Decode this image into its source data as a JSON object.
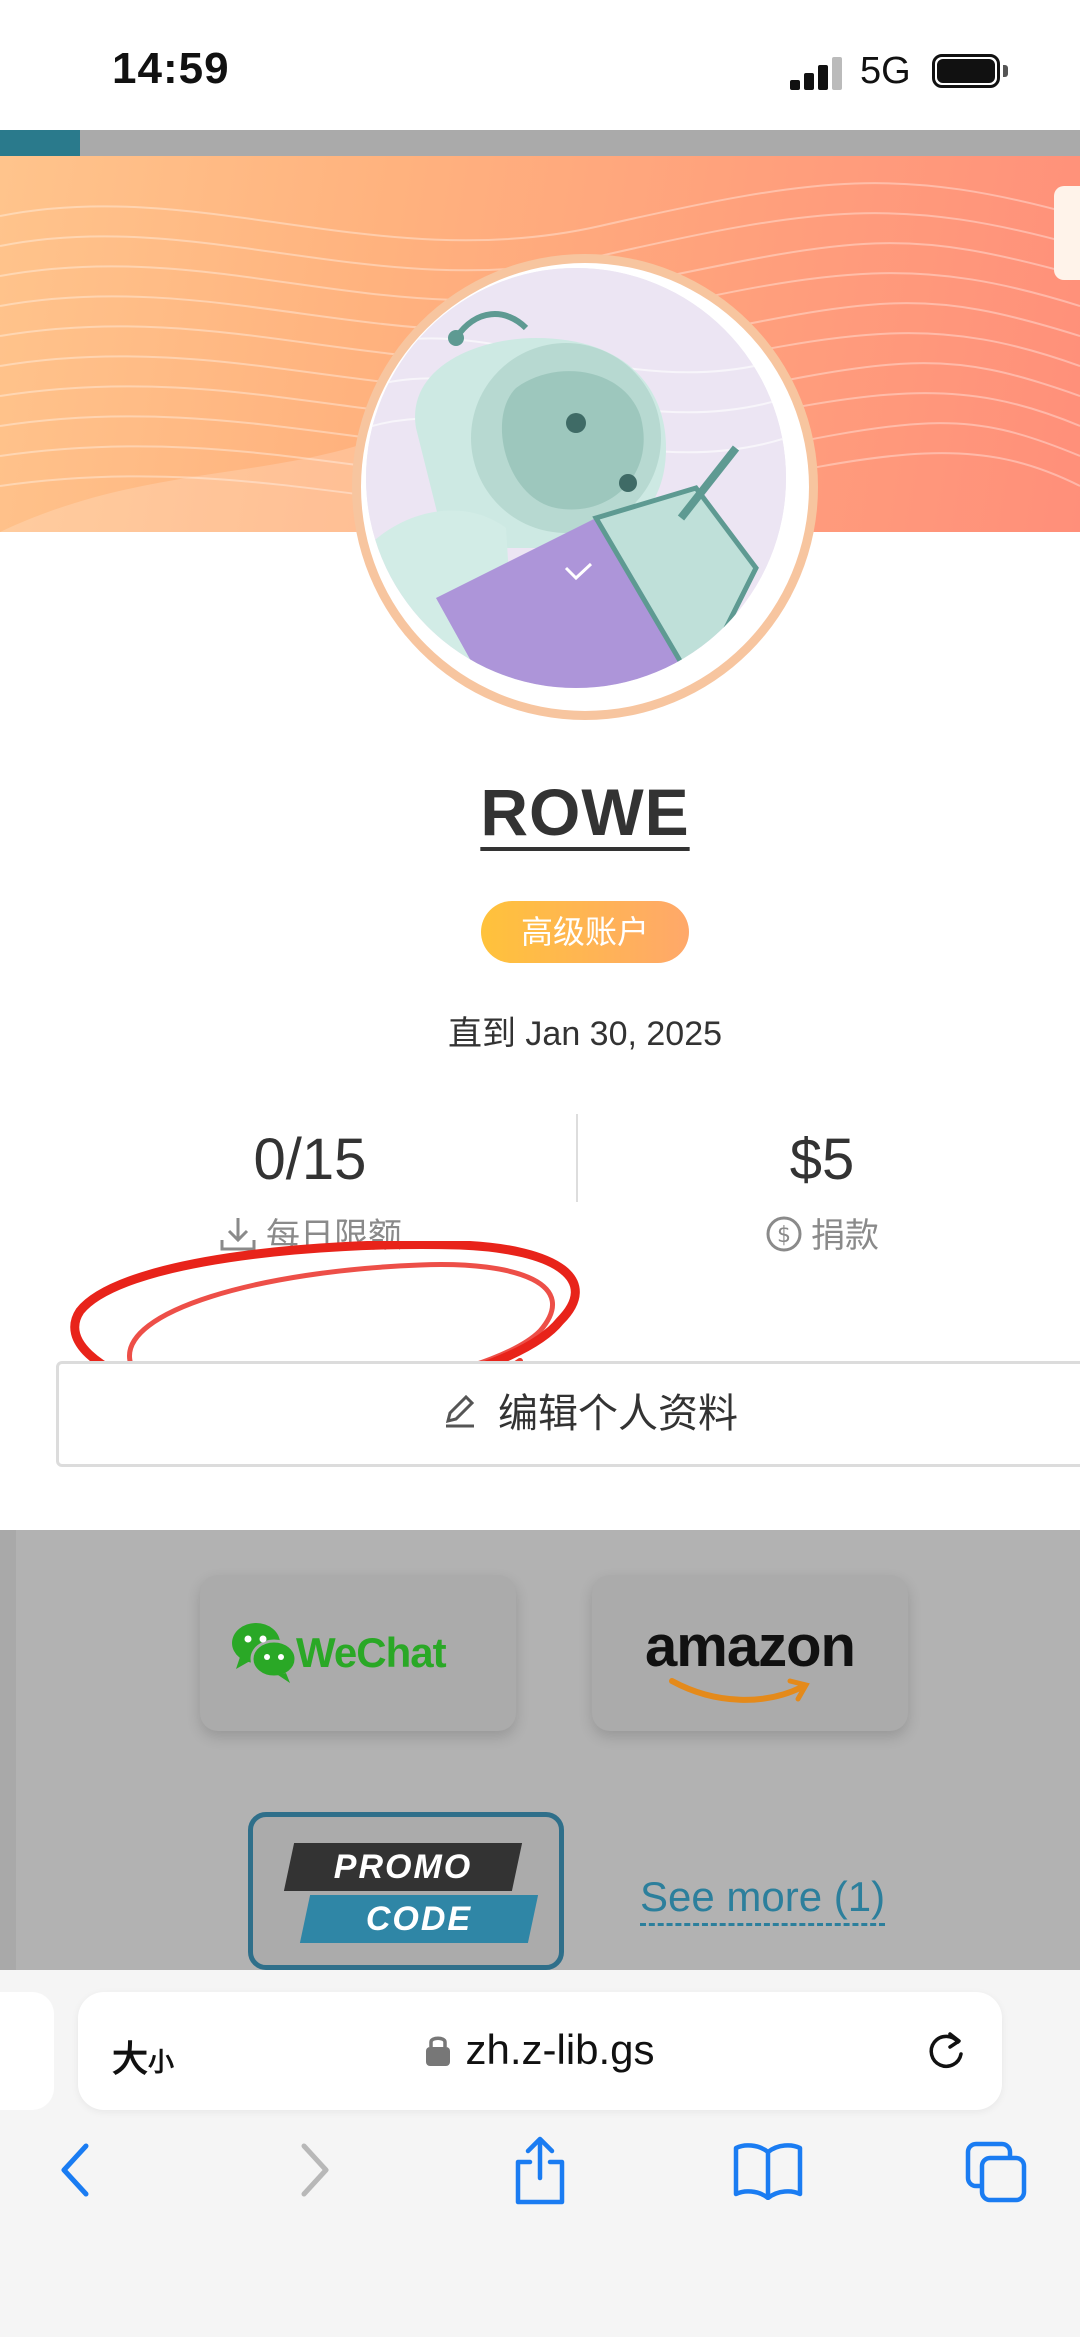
{
  "status_bar": {
    "time": "14:59",
    "network": "5G"
  },
  "profile": {
    "username": "ROWE",
    "account_badge": "高级账户",
    "valid_until": "直到 Jan 30, 2025",
    "stats": [
      {
        "value": "0/15",
        "label": "每日限额",
        "icon": "download-icon"
      },
      {
        "value": "$5",
        "label": "捐款",
        "icon": "dollar-circle-icon"
      }
    ],
    "edit_button_label": "编辑个人资料"
  },
  "payment_options": {
    "wechat_label": "WeChat",
    "amazon_label": "amazon",
    "promo_line1": "PROMO",
    "promo_line2": "CODE",
    "see_more": "See more (1)"
  },
  "browser": {
    "text_size_label_big": "大",
    "text_size_label_small": "小",
    "url": "zh.z-lib.gs"
  },
  "colors": {
    "badge_gradient_start": "#ffc23b",
    "badge_gradient_end": "#ffa86a",
    "banner_orange": "#ffb27e",
    "link_blue": "#2c7f9c",
    "safari_blue": "#1a7cf2",
    "annotation_red": "#e8231a"
  }
}
